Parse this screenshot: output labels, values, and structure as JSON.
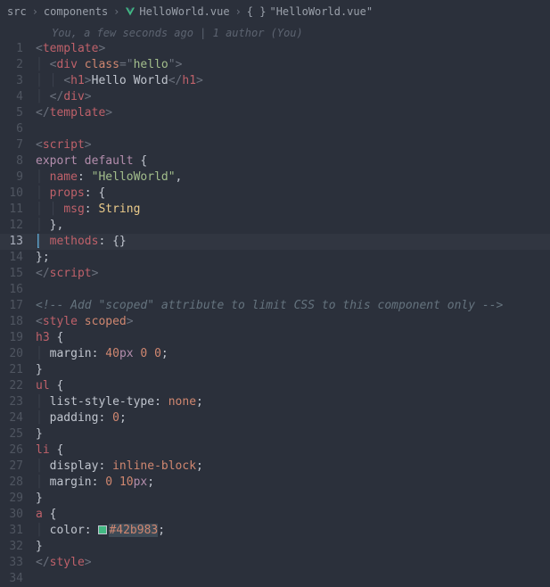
{
  "breadcrumb": {
    "seg1": "src",
    "seg2": "components",
    "seg3": "HelloWorld.vue",
    "seg4": "\"HelloWorld.vue\""
  },
  "git": {
    "annotation": "You, a few seconds ago | 1 author (You)"
  },
  "lines": {
    "n1": "1",
    "n2": "2",
    "n3": "3",
    "n4": "4",
    "n5": "5",
    "n6": "6",
    "n7": "7",
    "n8": "8",
    "n9": "9",
    "n10": "10",
    "n11": "11",
    "n12": "12",
    "n13": "13",
    "n14": "14",
    "n15": "15",
    "n16": "16",
    "n17": "17",
    "n18": "18",
    "n19": "19",
    "n20": "20",
    "n21": "21",
    "n22": "22",
    "n23": "23",
    "n24": "24",
    "n25": "25",
    "n26": "26",
    "n27": "27",
    "n28": "28",
    "n29": "29",
    "n30": "30",
    "n31": "31",
    "n32": "32",
    "n33": "33",
    "n34": "34"
  },
  "tok": {
    "lt": "<",
    "gt": ">",
    "lts": "</",
    "sp": " ",
    "q": "\"",
    "eq": "=",
    "cm": ",",
    "col": ":",
    "sc": ";",
    "lb": "{",
    "rb": "}",
    "lbr": "{}",
    "pipe": "│",
    "template": "template",
    "div": "div",
    "h1": "h1",
    "script": "script",
    "style": "style",
    "class": "class",
    "hello": "hello",
    "helloWorldTxt": "Hello World",
    "export": "export",
    "default": "default",
    "name": "name",
    "nameVal": "\"HelloWorld\"",
    "props": "props",
    "msg": "msg",
    "String": "String",
    "methods": "methods",
    "comment": "<!-- Add \"scoped\" attribute to limit CSS to this component only -->",
    "scoped": "scoped",
    "h3": "h3",
    "ul": "ul",
    "li": "li",
    "a": "a",
    "margin": "margin",
    "listStyleType": "list-style-type",
    "none": "none",
    "padding": "padding",
    "display": "display",
    "inlineBlock": "inline-block",
    "color": "color",
    "fortypx": "40",
    "zeropx": "0",
    "tenpx": "10",
    "px": "px",
    "colorHex": "#42b983"
  },
  "colors": {
    "swatch": "#42b983"
  }
}
